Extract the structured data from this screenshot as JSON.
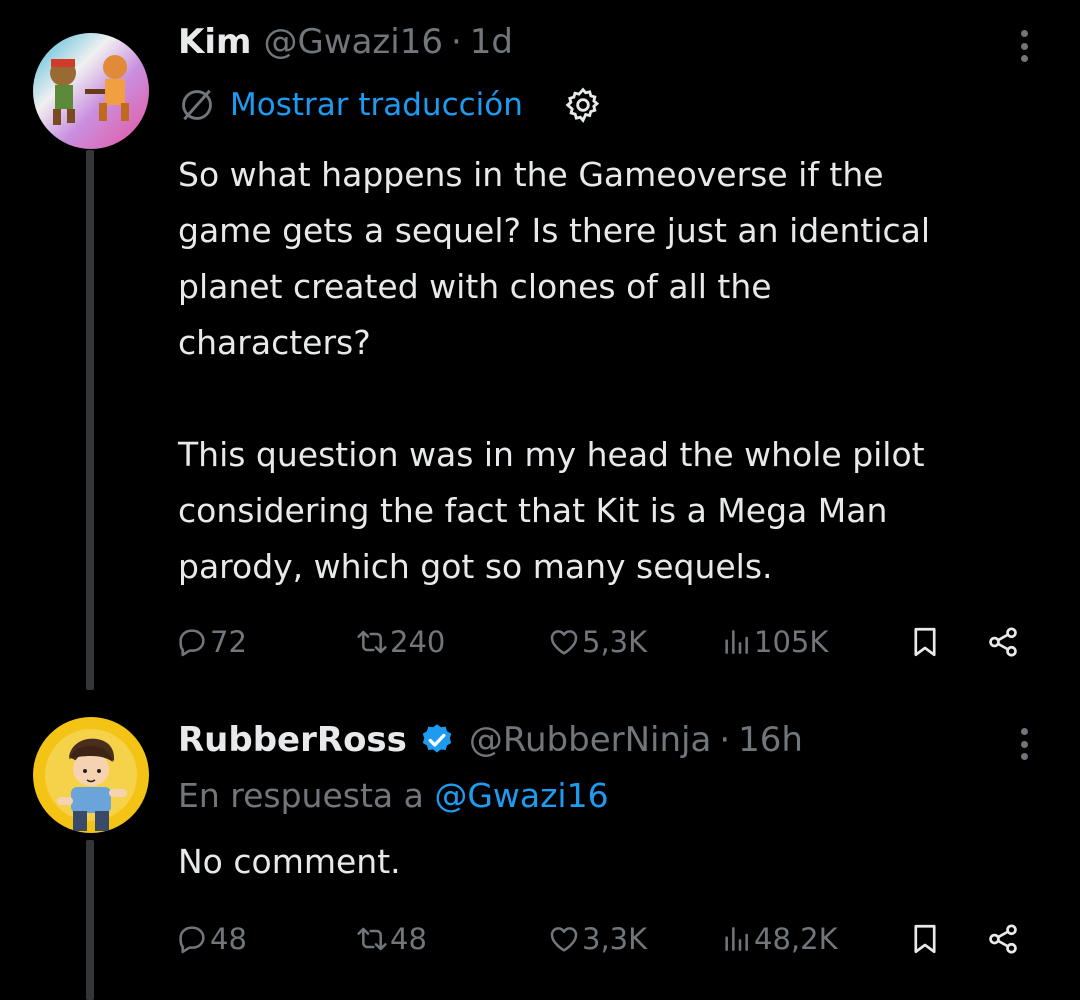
{
  "tweets": [
    {
      "author": {
        "name": "Kim",
        "handle": "@Gwazi16"
      },
      "separator": "·",
      "time": "1d",
      "translate_label": "Mostrar traducción",
      "text": "So what happens in the Gameoverse if the\ngame gets a sequel? Is there just an identical\nplanet created with clones of all the\ncharacters?\n\nThis question was in my head the whole pilot\nconsidering the fact that Kit is a Mega Man\nparody, which got so many sequels.",
      "stats": {
        "replies": "72",
        "reposts": "240",
        "likes": "5,3K",
        "views": "105K"
      }
    },
    {
      "author": {
        "name": "RubberRoss",
        "handle": "@RubberNinja"
      },
      "separator": "·",
      "time": "16h",
      "reply_prefix": "En respuesta a",
      "reply_mention": "@Gwazi16",
      "text": "No comment.",
      "stats": {
        "replies": "48",
        "reposts": "48",
        "likes": "3,3K",
        "views": "48,2K"
      }
    }
  ],
  "colors": {
    "background": "#000000",
    "text": "#e7e9ea",
    "muted": "#71767b",
    "accent": "#1d9bf0"
  },
  "icons": [
    "globe-slash-icon",
    "gear-icon",
    "more-icon",
    "verified-icon",
    "reply-icon",
    "repost-icon",
    "like-icon",
    "views-icon",
    "bookmark-icon",
    "share-icon"
  ]
}
